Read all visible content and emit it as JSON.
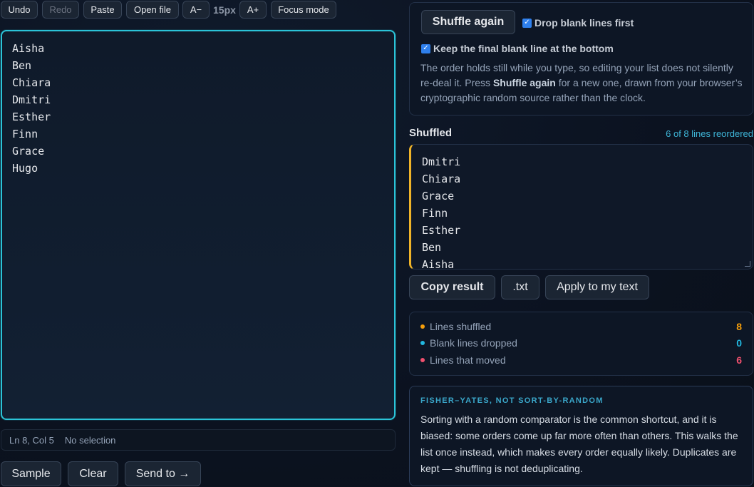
{
  "toolbar": {
    "undo": "Undo",
    "redo": "Redo",
    "paste": "Paste",
    "open_file": "Open file",
    "font_down": "A−",
    "font_size": "15px",
    "font_up": "A+",
    "focus_mode": "Focus mode"
  },
  "editor": {
    "lines": [
      "Aisha",
      "Ben",
      "Chiara",
      "Dmitri",
      "Esther",
      "Finn",
      "Grace",
      "Hugo"
    ],
    "status_position": "Ln 8, Col 5",
    "status_selection": "No selection"
  },
  "bottom_buttons": {
    "sample": "Sample",
    "clear": "Clear",
    "send_to": "Send to →"
  },
  "options": {
    "shuffle_again": "Shuffle again",
    "drop_blank_label": "Drop blank lines first",
    "drop_blank_checked": true,
    "keep_final_label": "Keep the final blank line at the bottom",
    "keep_final_checked": true,
    "desc_1": "The order holds still while you type, so editing your list does not silently re-deal it. Press ",
    "desc_bold": "Shuffle again",
    "desc_2": " for a new one, drawn from your browser’s cryptographic random source rather than the clock."
  },
  "shuffled": {
    "title": "Shuffled",
    "count": "6 of 8 lines reordered",
    "lines": [
      "Dmitri",
      "Chiara",
      "Grace",
      "Finn",
      "Esther",
      "Ben",
      "Aisha"
    ],
    "copy": "Copy result",
    "txt": ".txt",
    "apply": "Apply to my text"
  },
  "stats": [
    {
      "label": "Lines shuffled",
      "value": "8",
      "color": "#f59e0b"
    },
    {
      "label": "Blank lines dropped",
      "value": "0",
      "color": "#22b8e0"
    },
    {
      "label": "Lines that moved",
      "value": "6",
      "color": "#f0506e"
    }
  ],
  "info": {
    "heading": "FISHER–YATES, NOT SORT-BY-RANDOM",
    "body": "Sorting with a random comparator is the common shortcut, and it is biased: some orders come up far more often than others. This walks the list once instead, which makes every order equally likely. Duplicates are kept — shuffling is not deduplicating."
  }
}
